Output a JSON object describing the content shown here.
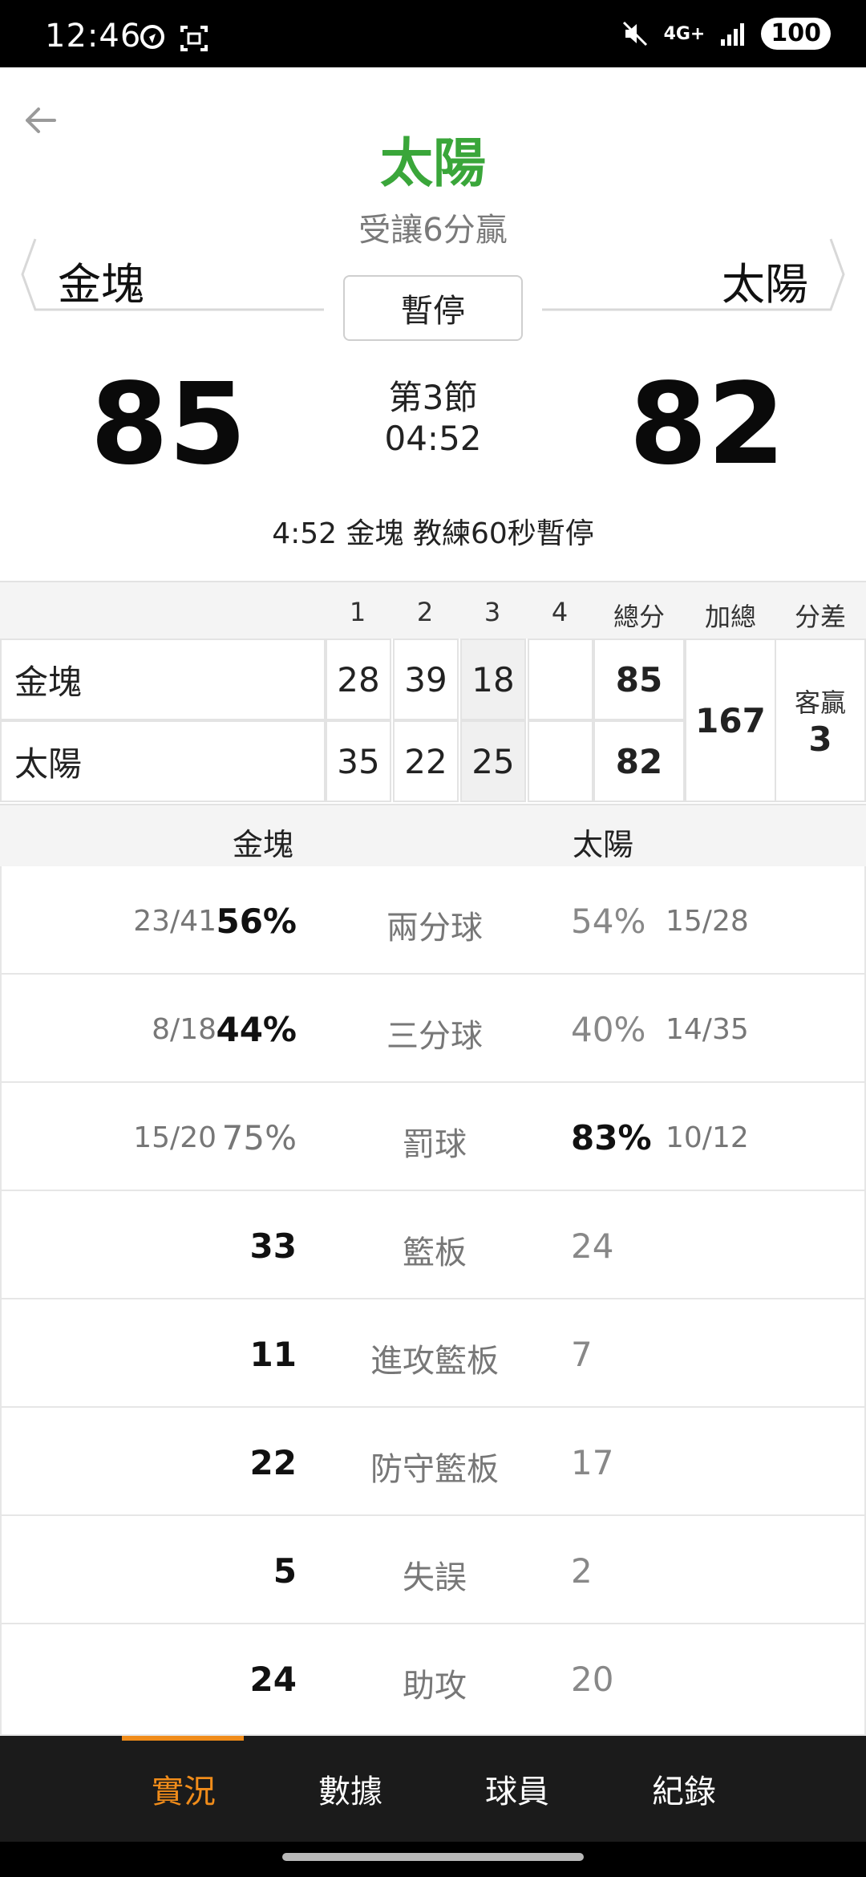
{
  "status_bar": {
    "time": "12:46",
    "network": "4G+",
    "battery": "100"
  },
  "header": {
    "winner": "太陽",
    "odds": "受讓6分贏",
    "game_status": "暫停",
    "period": "第3節",
    "clock": "04:52",
    "event": "4:52 金塊  教練60秒暫停"
  },
  "teams": {
    "away": {
      "name": "金塊",
      "score": "85"
    },
    "home": {
      "name": "太陽",
      "score": "82"
    }
  },
  "quarter_table": {
    "headers": [
      "1",
      "2",
      "3",
      "4",
      "總分",
      "加總",
      "分差"
    ],
    "rows": [
      {
        "team": "金塊",
        "q": [
          "28",
          "39",
          "18",
          ""
        ],
        "total": "85"
      },
      {
        "team": "太陽",
        "q": [
          "35",
          "22",
          "25",
          ""
        ],
        "total": "82"
      }
    ],
    "sum": "167",
    "diff_label": "客贏",
    "diff_value": "3"
  },
  "stats": {
    "away_team": "金塊",
    "home_team": "太陽",
    "rows": [
      {
        "label": "兩分球",
        "l_ratio": "23/41",
        "l_val": "56%",
        "r_val": "54%",
        "r_ratio": "15/28"
      },
      {
        "label": "三分球",
        "l_ratio": "8/18",
        "l_val": "44%",
        "r_val": "40%",
        "r_ratio": "14/35"
      },
      {
        "label": "罰球",
        "l_ratio": "15/20",
        "l_val": "75%",
        "r_val": "83%",
        "r_ratio": "10/12"
      },
      {
        "label": "籃板",
        "l_ratio": "",
        "l_val": "33",
        "r_val": "24",
        "r_ratio": ""
      },
      {
        "label": "進攻籃板",
        "l_ratio": "",
        "l_val": "11",
        "r_val": "7",
        "r_ratio": ""
      },
      {
        "label": "防守籃板",
        "l_ratio": "",
        "l_val": "22",
        "r_val": "17",
        "r_ratio": ""
      },
      {
        "label": "失誤",
        "l_ratio": "",
        "l_val": "5",
        "r_val": "2",
        "r_ratio": ""
      },
      {
        "label": "助攻",
        "l_ratio": "",
        "l_val": "24",
        "r_val": "20",
        "r_ratio": ""
      }
    ]
  },
  "bottom_nav": {
    "items": [
      "實況",
      "數據",
      "球員",
      "紀錄"
    ],
    "active": "實況"
  },
  "colors": {
    "winner_green": "#3aa63a",
    "accent_orange": "#f08c1a",
    "nav_bg": "#1b1b1b"
  }
}
